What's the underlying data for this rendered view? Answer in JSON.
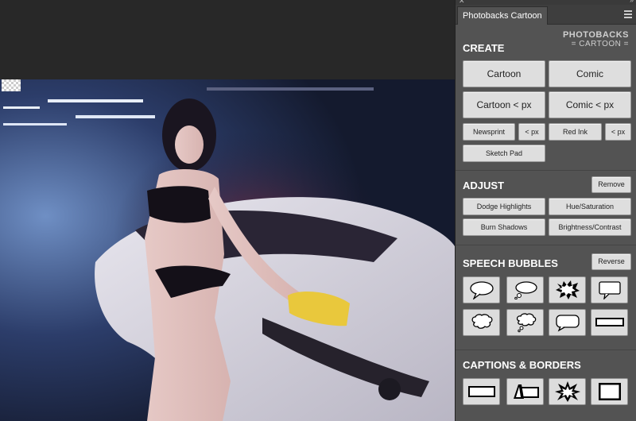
{
  "panel": {
    "tab_title": "Photobacks Cartoon",
    "logo_line1": "PHOTOBACKS",
    "logo_line2": "= CARTOON ="
  },
  "create": {
    "title": "CREATE",
    "cartoon": "Cartoon",
    "comic": "Comic",
    "cartoon_px": "Cartoon < px",
    "comic_px": "Comic < px",
    "newsprint": "Newsprint",
    "newsprint_px": "< px",
    "red_ink": "Red Ink",
    "red_ink_px": "< px",
    "sketch_pad": "Sketch Pad"
  },
  "adjust": {
    "title": "ADJUST",
    "remove": "Remove",
    "dodge": "Dodge Highlights",
    "hue": "Hue/Saturation",
    "burn": "Burn Shadows",
    "brightness": "Brightness/Contrast"
  },
  "speech": {
    "title": "SPEECH BUBBLES",
    "reverse": "Reverse",
    "bubbles": [
      "speech-oval-icon",
      "thought-bubble-icon",
      "shout-burst-icon",
      "speech-rectangle-icon",
      "cloud-bubble-icon",
      "thought-cloud-icon",
      "rounded-speech-icon",
      "banner-caption-icon"
    ]
  },
  "captions": {
    "title": "CAPTIONS & BORDERS",
    "items": [
      "caption-box-icon",
      "caption-tab-icon",
      "starburst-icon",
      "frame-border-icon"
    ]
  }
}
